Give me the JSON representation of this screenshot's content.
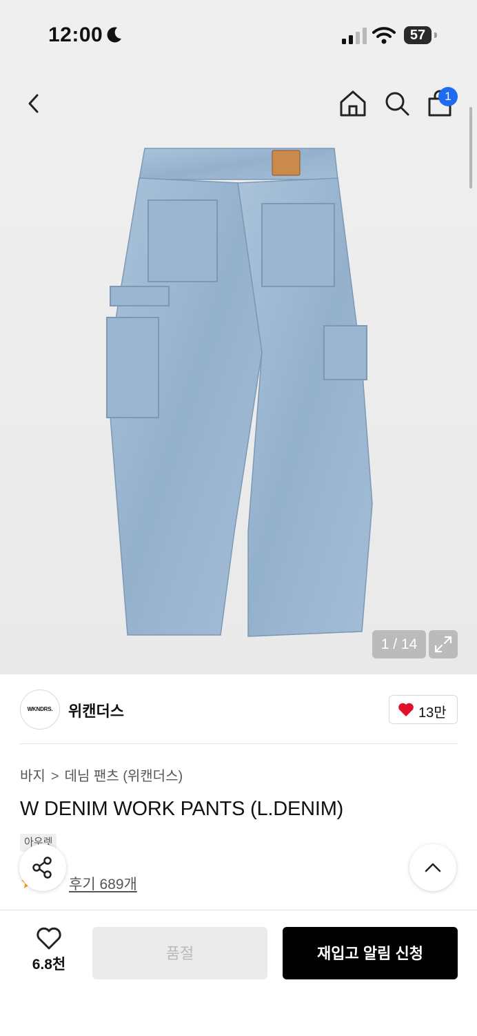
{
  "status_bar": {
    "time": "12:00",
    "battery": "57"
  },
  "hero": {
    "image_counter": "1 / 14",
    "cart_badge_count": "1"
  },
  "brand": {
    "logo_text": "WKNDRS.",
    "name": "위캔더스",
    "likes": "13만"
  },
  "breadcrumb": {
    "category": "바지",
    "separator": ">",
    "subcategory": "데님 팬츠 (위캔더스)"
  },
  "product": {
    "title": "W DENIM WORK PANTS (L.DENIM)",
    "tag": "아우렛",
    "review_link": "후기 689개"
  },
  "bottom_bar": {
    "wish_count": "6.8천",
    "soldout_label": "품절",
    "restock_label": "재입고 알림 신청"
  },
  "colors": {
    "accent_blue": "#1f6af0",
    "heart_red": "#e0112b",
    "denim": "#9db8d2"
  }
}
